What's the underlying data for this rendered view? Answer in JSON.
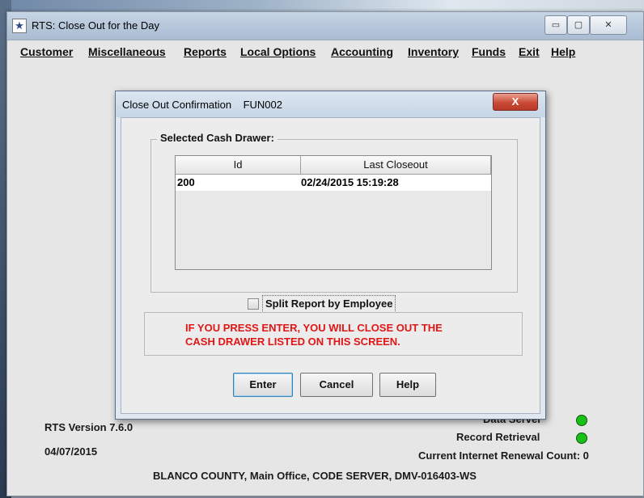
{
  "window": {
    "title": "RTS: Close Out for the Day",
    "app_icon": "star-icon",
    "minimize_glyph": "▭",
    "maximize_glyph": "▢",
    "close_glyph": "✕"
  },
  "menu": [
    {
      "label": "Customer"
    },
    {
      "label": "Miscellaneous"
    },
    {
      "label": "Reports"
    },
    {
      "label": "Local Options"
    },
    {
      "label": "Accounting"
    },
    {
      "label": "Inventory"
    },
    {
      "label": "Funds"
    },
    {
      "label": "Exit"
    },
    {
      "label": "Help"
    }
  ],
  "dialog": {
    "title": "Close Out Confirmation",
    "code": "FUN002",
    "close_glyph": "X",
    "group_label": "Selected Cash Drawer:",
    "table": {
      "columns": [
        "Id",
        "Last Closeout"
      ],
      "rows": [
        {
          "id": "200",
          "last_closeout": "02/24/2015  15:19:28"
        }
      ]
    },
    "checkbox": {
      "label": "Split Report by Employee",
      "checked": false
    },
    "warning": {
      "line1": "IF YOU PRESS ENTER, YOU WILL CLOSE OUT THE",
      "line2": "CASH DRAWER LISTED ON THIS SCREEN."
    },
    "buttons": {
      "enter": "Enter",
      "cancel": "Cancel",
      "help": "Help"
    }
  },
  "status": {
    "version": "RTS Version 7.6.0",
    "date": "04/07/2015",
    "data_server": "Data Server",
    "record_retrieval": "Record Retrieval",
    "renewal_count": "Current Internet Renewal Count: 0",
    "office_line": "BLANCO COUNTY, Main Office, CODE SERVER, DMV-016403-WS",
    "indicator_color": "#18c018"
  },
  "colors": {
    "warning_text": "#e01616",
    "dialog_close": "#c94b36"
  }
}
